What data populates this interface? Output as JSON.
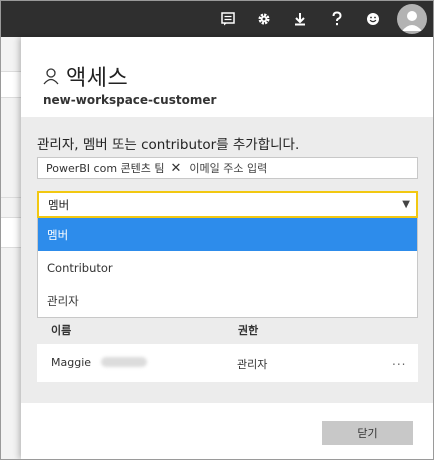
{
  "topbar": {
    "icons": [
      "feedback-icon",
      "gear-icon",
      "download-icon",
      "help-icon",
      "smiley-icon",
      "avatar"
    ],
    "background": "#2f2f2f"
  },
  "panel": {
    "title": "액세스",
    "workspace": "new-workspace-customer",
    "instruction": "관리자, 멤버 또는 contributor를 추가합니다.",
    "chip_label": "PowerBI com 콘텐츠 팀",
    "email_placeholder": "이메일 주소 입력",
    "select_value": "멤버",
    "dropdown_options": [
      "멤버",
      "Contributor",
      "관리자"
    ],
    "selected_option_index": 0,
    "columns": {
      "name": "이름",
      "permission": "권한"
    },
    "rows": [
      {
        "name": "Maggie",
        "role": "관리자",
        "more": "..."
      }
    ],
    "close_label": "닫기"
  },
  "colors": {
    "accent_yellow": "#f2c811",
    "selected_blue": "#2d8ceb",
    "panel_gray": "#ececec"
  }
}
